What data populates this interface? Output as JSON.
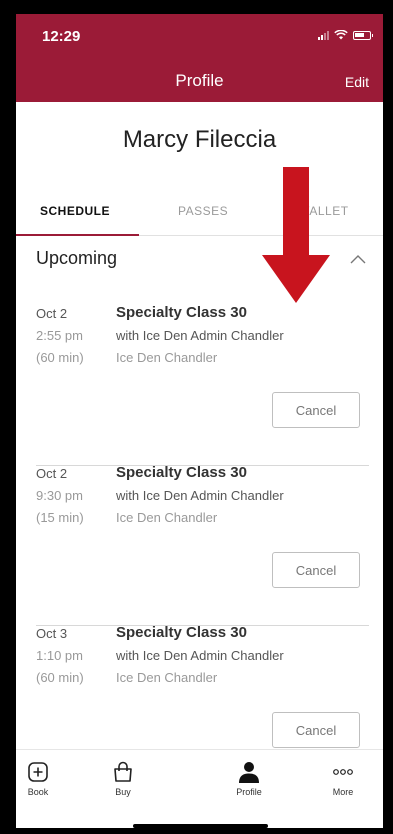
{
  "status_bar": {
    "time": "12:29"
  },
  "header": {
    "title": "Profile",
    "edit_label": "Edit"
  },
  "profile": {
    "name": "Marcy Fileccia"
  },
  "tabs": [
    {
      "label": "SCHEDULE",
      "active": true
    },
    {
      "label": "PASSES",
      "active": false
    },
    {
      "label": "WALLET",
      "active": false
    }
  ],
  "section": {
    "title": "Upcoming"
  },
  "bookings": [
    {
      "date": "Oct 2",
      "time": "2:55 pm",
      "duration": "(60 min)",
      "title": "Specialty Class 30",
      "instructor": "with Ice Den Admin Chandler",
      "location": "Ice Den Chandler",
      "cancel_label": "Cancel"
    },
    {
      "date": "Oct 2",
      "time": "9:30 pm",
      "duration": "(15 min)",
      "title": "Specialty Class 30",
      "instructor": "with Ice Den Admin Chandler",
      "location": "Ice Den Chandler",
      "cancel_label": "Cancel"
    },
    {
      "date": "Oct 3",
      "time": "1:10 pm",
      "duration": "(60 min)",
      "title": "Specialty Class 30",
      "instructor": "with Ice Den Admin Chandler",
      "location": "Ice Den Chandler",
      "cancel_label": "Cancel"
    }
  ],
  "bottom_nav": [
    {
      "label": "Book",
      "icon": "plus-square-icon"
    },
    {
      "label": "Buy",
      "icon": "shopping-bag-icon"
    },
    {
      "label": "Profile",
      "icon": "person-icon",
      "active": true
    },
    {
      "label": "More",
      "icon": "more-dots-icon"
    }
  ],
  "colors": {
    "brand": "#9b1b37",
    "annotation_arrow": "#c8141e"
  }
}
